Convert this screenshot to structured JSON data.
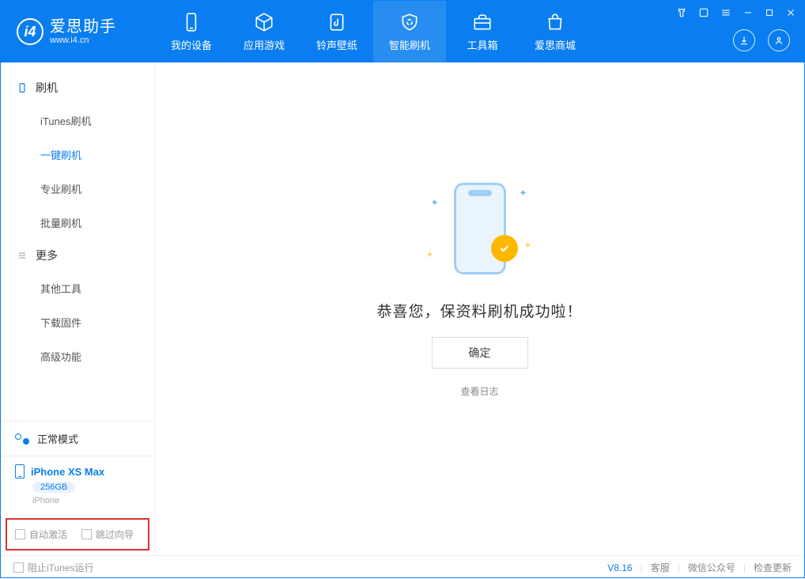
{
  "app": {
    "title": "爱思助手",
    "subtitle": "www.i4.cn"
  },
  "nav": {
    "my_device": "我的设备",
    "apps_games": "应用游戏",
    "ringtones": "铃声壁纸",
    "smart_flash": "智能刷机",
    "toolbox": "工具箱",
    "store": "爱思商城"
  },
  "sidebar": {
    "group_flash": "刷机",
    "items_flash": [
      "iTunes刷机",
      "一键刷机",
      "专业刷机",
      "批量刷机"
    ],
    "group_more": "更多",
    "items_more": [
      "其他工具",
      "下载固件",
      "高级功能"
    ]
  },
  "device": {
    "mode_label": "正常模式",
    "name": "iPhone XS Max",
    "capacity": "256GB",
    "type": "iPhone"
  },
  "options": {
    "auto_activate": "自动激活",
    "skip_guide": "跳过向导"
  },
  "main": {
    "success_message": "恭喜您，保资料刷机成功啦！",
    "ok_button": "确定",
    "view_log": "查看日志"
  },
  "statusbar": {
    "block_itunes": "阻止iTunes运行",
    "version": "V8.16",
    "support": "客服",
    "wechat": "微信公众号",
    "check_update": "检查更新"
  }
}
